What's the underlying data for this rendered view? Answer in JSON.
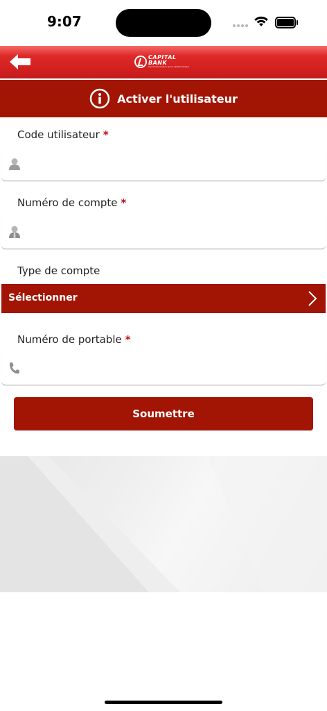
{
  "status_bar": {
    "time": "9:07"
  },
  "header": {
    "back_icon": "arrow-left-icon",
    "logo_text_line1": "CAPITAL",
    "logo_text_line2": "BANK",
    "logo_tagline": "Il ya toujours plus qu'un simple banque",
    "title": "Activer l'utilisateur",
    "title_icon": "info-circle-icon"
  },
  "form": {
    "user_code": {
      "label": "Code utilisateur",
      "required_mark": "*",
      "icon": "user-icon",
      "value": ""
    },
    "account_number": {
      "label": "Numéro de compte",
      "required_mark": "*",
      "icon": "account-holder-icon",
      "value": ""
    },
    "account_type": {
      "label": "Type de compte",
      "selected": "Sélectionner",
      "icon": "chevron-right-icon"
    },
    "mobile_number": {
      "label": "Numéro de portable",
      "required_mark": "*",
      "icon": "phone-icon",
      "value": ""
    },
    "submit_label": "Soumettre"
  },
  "colors": {
    "primary": "#a21505",
    "header_red": "#d62222",
    "required": "#c0101a"
  }
}
